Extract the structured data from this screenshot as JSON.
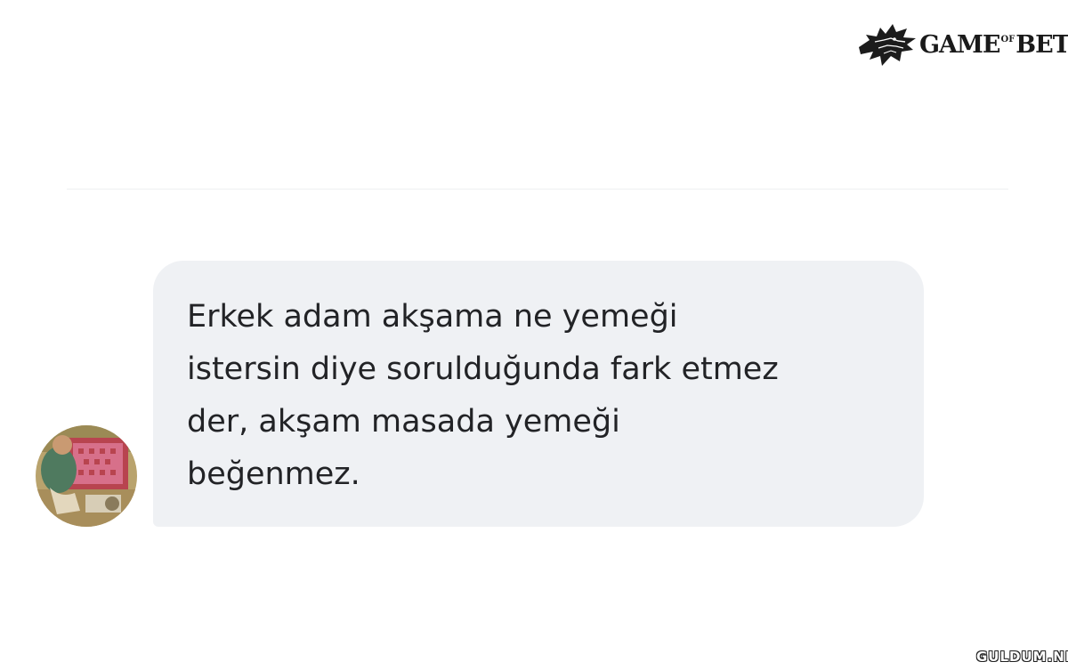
{
  "logo": {
    "icon": "wolf-head-icon",
    "text_main": "GAME",
    "text_sup": "OF",
    "text_end": "BET"
  },
  "message": {
    "text": "Erkek adam akşama ne yemeği\nistersin diye sorulduğunda fark etmez\nder, akşam masada yemeği\nbeğenmez."
  },
  "avatar": {
    "icon": "user-avatar-illustration"
  },
  "watermark": {
    "text": "GULDUM.NET"
  },
  "colors": {
    "bubble_background": "#eff1f4",
    "message_text": "#222326",
    "divider": "#eeeff1"
  }
}
